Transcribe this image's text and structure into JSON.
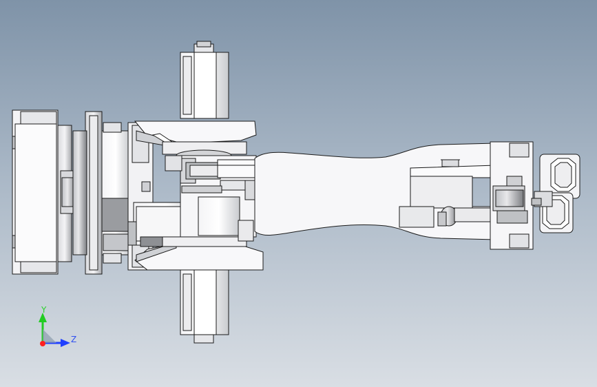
{
  "triad": {
    "y_label": "Y",
    "z_label": "Z",
    "y_color": "#22cc22",
    "z_color": "#2040ff",
    "x_color": "#ff2020"
  },
  "colors": {
    "background_top": "#7f93a8",
    "background_bottom": "#d9dee4",
    "part_fill": "#f6f6f8",
    "part_shade": "#d6d8dc",
    "dark_shade": "#8a8c90",
    "edge": "#1a1a1a"
  }
}
